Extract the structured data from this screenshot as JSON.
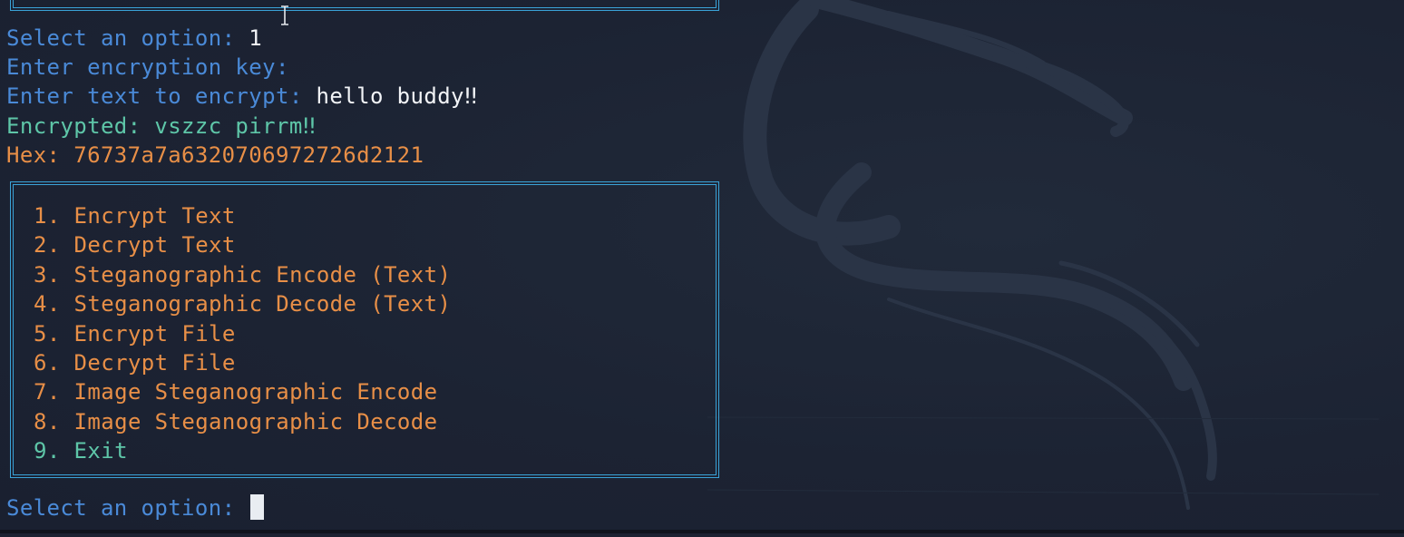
{
  "terminal": {
    "prompt_select": "Select an option: ",
    "selected_value": "1",
    "prompt_key": "Enter encryption key:",
    "prompt_text": "Enter text to encrypt: ",
    "input_text": "hello buddy‼",
    "encrypted_line": "Encrypted: vszzc pirrm‼",
    "hex_line": "Hex: 76737a7a6320706972726d2121",
    "prompt_select_current": "Select an option: "
  },
  "menu": {
    "items": [
      {
        "label": "1. Encrypt Text",
        "color": "#e88f47"
      },
      {
        "label": "2. Decrypt Text",
        "color": "#e88f47"
      },
      {
        "label": "3. Steganographic Encode (Text)",
        "color": "#e88f47"
      },
      {
        "label": "4. Steganographic Decode (Text)",
        "color": "#e88f47"
      },
      {
        "label": "5. Encrypt File",
        "color": "#e88f47"
      },
      {
        "label": "6. Decrypt File",
        "color": "#e88f47"
      },
      {
        "label": "7. Image Steganographic Encode",
        "color": "#e88f47"
      },
      {
        "label": "8. Image Steganographic Decode",
        "color": "#e88f47"
      },
      {
        "label": "9. Exit",
        "color": "#5ec6a8"
      }
    ],
    "border_color": "#3aa3d8"
  },
  "icons": {
    "mouse_cursor": "text-ibeam-cursor-icon",
    "wallpaper": "kali-dragon-logo"
  }
}
